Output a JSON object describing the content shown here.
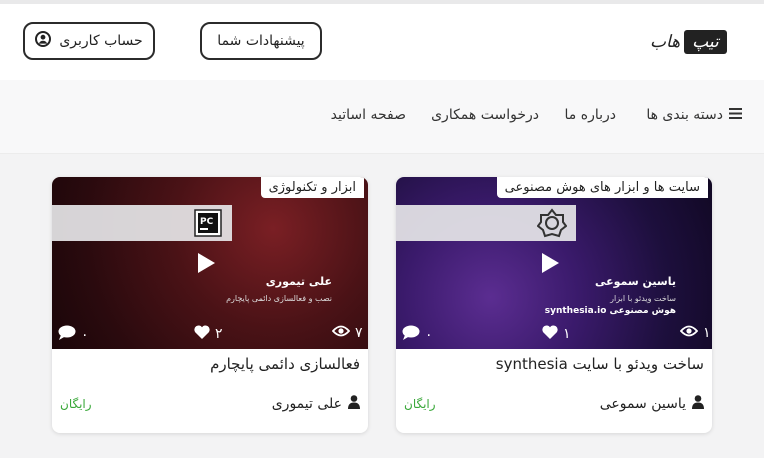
{
  "header": {
    "account_label": "حساب کاربری",
    "suggest_label": "پیشنهادات شما",
    "logo_box": "تیپ",
    "logo_text": "هاب"
  },
  "nav": {
    "categories_label": "دسته بندی ها",
    "about_label": "درباره ما",
    "cooperation_label": "درخواست همکاری",
    "teachers_label": "صفحه اساتید"
  },
  "cards": [
    {
      "tag": "سایت ها و ابزار های هوش مصنوعی",
      "overlay_title": "یاسین سموعی",
      "overlay_sub1": "ساخت ویدئو با ابزار",
      "overlay_sub2": "هوش مصنوعی synthesia.io",
      "views": "۱",
      "likes": "۱",
      "comments": "۰",
      "title": "ساخت ویدئو با سایت synthesia",
      "author": "یاسین سموعی",
      "price": "رایگان"
    },
    {
      "tag": "ابزار و تکنولوژی",
      "overlay_title": "علی تیموری",
      "overlay_sub1": "نصب و فعالسازی دائمی پایچارم",
      "overlay_sub2": "",
      "views": "۷",
      "likes": "۲",
      "comments": "۰",
      "title": "فعالسازی دائمی پایچارم",
      "author": "علی تیموری",
      "price": "رایگان"
    }
  ]
}
